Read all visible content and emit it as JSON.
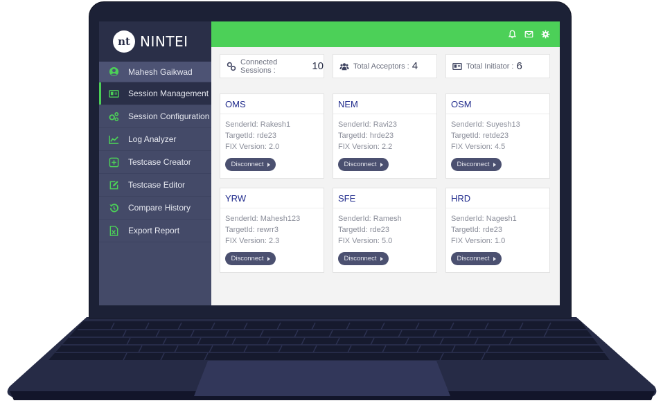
{
  "app": {
    "brand_name": "NINTEI",
    "logo_text": "nt"
  },
  "sidebar": {
    "user": {
      "label": "Mahesh Gaikwad",
      "icon": "user-circle-icon"
    },
    "items": [
      {
        "label": "Session Management",
        "icon": "id-card-icon",
        "active": true
      },
      {
        "label": "Session Configuration",
        "icon": "cogs-icon",
        "active": false
      },
      {
        "label": "Log Analyzer",
        "icon": "line-chart-icon",
        "active": false
      },
      {
        "label": "Testcase Creator",
        "icon": "plus-square-icon",
        "active": false
      },
      {
        "label": "Testcase Editor",
        "icon": "edit-icon",
        "active": false
      },
      {
        "label": "Compare History",
        "icon": "history-icon",
        "active": false
      },
      {
        "label": "Export Report",
        "icon": "excel-file-icon",
        "active": false
      }
    ]
  },
  "topbar": {
    "icons": [
      "bell-icon",
      "envelope-icon",
      "gear-icon"
    ]
  },
  "stats": [
    {
      "label": "Connected Sessions :",
      "value": "10",
      "icon": "link-icon"
    },
    {
      "label": "Total Acceptors :",
      "value": "4",
      "icon": "users-icon"
    },
    {
      "label": "Total Initiator :",
      "value": "6",
      "icon": "id-card-icon"
    }
  ],
  "sessions": [
    {
      "name": "OMS",
      "sender": "SenderId: Rakesh1",
      "target": "TargetId: rde23",
      "fix": "FIX Version: 2.0",
      "button": "Disconnect"
    },
    {
      "name": "NEM",
      "sender": "SenderId: Ravi23",
      "target": "TargetId: hrde23",
      "fix": "FIX Version: 2.2",
      "button": "Disconnect"
    },
    {
      "name": "OSM",
      "sender": "SenderId: Suyesh13",
      "target": "TargetId: retde23",
      "fix": "FIX Version: 4.5",
      "button": "Disconnect"
    },
    {
      "name": "YRW",
      "sender": "SenderId: Mahesh123",
      "target": "TargetId: rewrr3",
      "fix": "FIX Version: 2.3",
      "button": "Disconnect"
    },
    {
      "name": "SFE",
      "sender": "SenderId: Ramesh",
      "target": "TargetId: rde23",
      "fix": "FIX Version: 5.0",
      "button": "Disconnect"
    },
    {
      "name": "HRD",
      "sender": "SenderId: Nagesh1",
      "target": "TargetId: rde23",
      "fix": "FIX Version: 1.0",
      "button": "Disconnect"
    }
  ],
  "colors": {
    "accent": "#4cd058",
    "sidebar": "#444a68",
    "sidebar_dark": "#2a2f48",
    "card_title": "#1f2a8c",
    "button": "#4b5070",
    "laptop_body": "#1c2136"
  }
}
